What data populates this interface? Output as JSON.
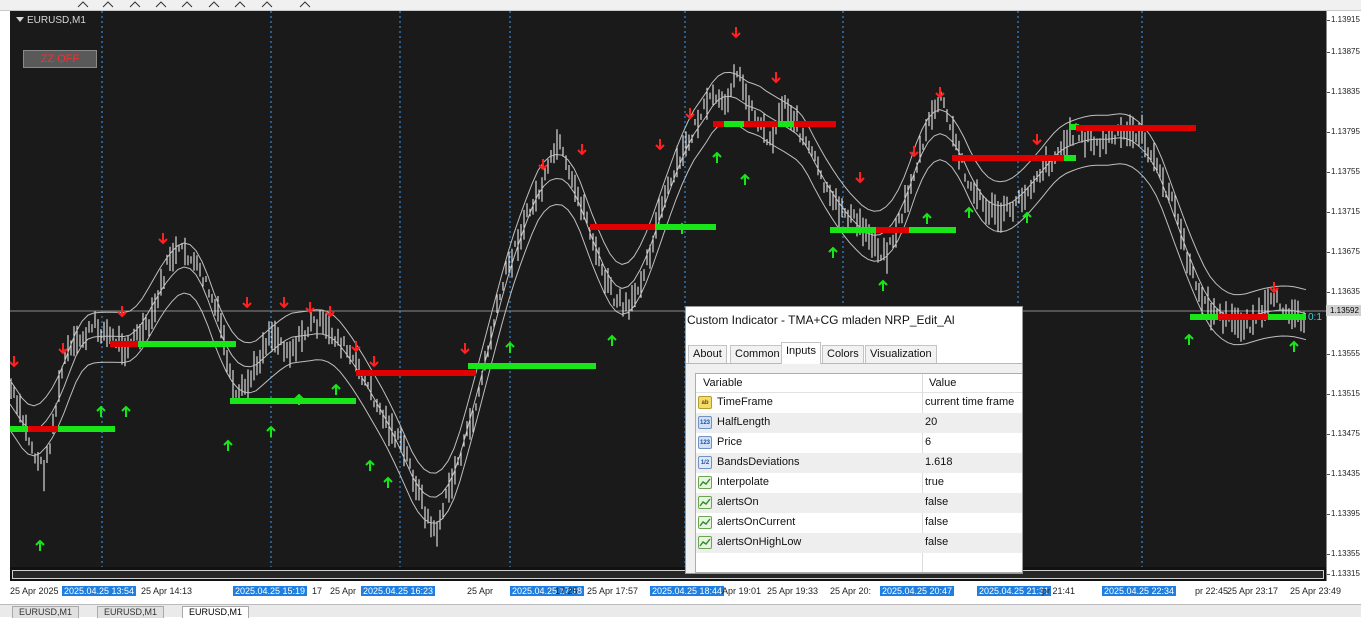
{
  "toolbar": {
    "icons": [
      "arrow-icon",
      "line-icon",
      "pitchfork-icon",
      "fibo-icon",
      "text-icon",
      "shapes-icon",
      "period-icon",
      "template-icon",
      "dropdown-icon"
    ]
  },
  "chart": {
    "symbol": "EURUSD,M1",
    "zz_button": "ZZ OFF",
    "current_price_label": "1.13592",
    "right_edge_text": "0:1",
    "colors": {
      "background": "#1a1a1a",
      "candles": "#ffffff",
      "bands": "#bfbfbf",
      "up_arrow": "#19e619",
      "down_arrow": "#ff2020",
      "sr_green": "#19e619",
      "sr_red": "#e00000",
      "separator": "#3aa0ff"
    }
  },
  "price_scale": [
    "1.13915",
    "1.13875",
    "1.13835",
    "1.13795",
    "1.13755",
    "1.13715",
    "1.13675",
    "1.13635",
    "1.13555",
    "1.13515",
    "1.13475",
    "1.13435",
    "1.13395",
    "1.13355",
    "1.13315"
  ],
  "time_scale": [
    {
      "text": "25 Apr 2025",
      "hl": false
    },
    {
      "text": "2025.04.25 13:54",
      "hl": true
    },
    {
      "text": "25 Apr 14:13",
      "hl": false
    },
    {
      "text": "2025.04.25 15:19",
      "hl": true
    },
    {
      "text": "17",
      "hl": false
    },
    {
      "text": "25 Apr",
      "hl": false
    },
    {
      "text": "2025.04.25 16:23",
      "hl": true
    },
    {
      "text": "25 Apr",
      "hl": false
    },
    {
      "text": "2025.04.25 17:18",
      "hl": true
    },
    {
      "text": "17:25",
      "hl": false
    },
    {
      "text": "25 Apr 17:57",
      "hl": false
    },
    {
      "text": "2025.04.25 18:44",
      "hl": true
    },
    {
      "text": "Apr 19:01",
      "hl": false
    },
    {
      "text": "25 Apr 19:33",
      "hl": false
    },
    {
      "text": "25 Apr 20:",
      "hl": false
    },
    {
      "text": "2025.04.25 20:47",
      "hl": true
    },
    {
      "text": "2025.04.25 21:31",
      "hl": true
    },
    {
      "text": "pr 21:41",
      "hl": false
    },
    {
      "text": "2025.04.25 22:34",
      "hl": true
    },
    {
      "text": "pr 22:45",
      "hl": false
    },
    {
      "text": "25 Apr 23:17",
      "hl": false
    },
    {
      "text": "25 Apr 23:49",
      "hl": false
    }
  ],
  "tabs": [
    "EURUSD,M1",
    "EURUSD,M1",
    "EURUSD,M1"
  ],
  "dialog": {
    "title": "Custom Indicator - TMA+CG mladen NRP_Edit_Al",
    "tabs": [
      "About",
      "Common",
      "Inputs",
      "Colors",
      "Visualization"
    ],
    "active_tab": "Inputs",
    "columns": [
      "Variable",
      "Value"
    ],
    "params": [
      {
        "type": "string",
        "name": "TimeFrame",
        "value": "current time frame"
      },
      {
        "type": "int",
        "name": "HalfLength",
        "value": "20"
      },
      {
        "type": "int",
        "name": "Price",
        "value": "6"
      },
      {
        "type": "double",
        "name": "BandsDeviations",
        "value": "1.618"
      },
      {
        "type": "bool",
        "name": "Interpolate",
        "value": "true"
      },
      {
        "type": "bool",
        "name": "alertsOn",
        "value": "false"
      },
      {
        "type": "bool",
        "name": "alertsOnCurrent",
        "value": "false"
      },
      {
        "type": "bool",
        "name": "alertsOnHighLow",
        "value": "false"
      }
    ]
  }
}
